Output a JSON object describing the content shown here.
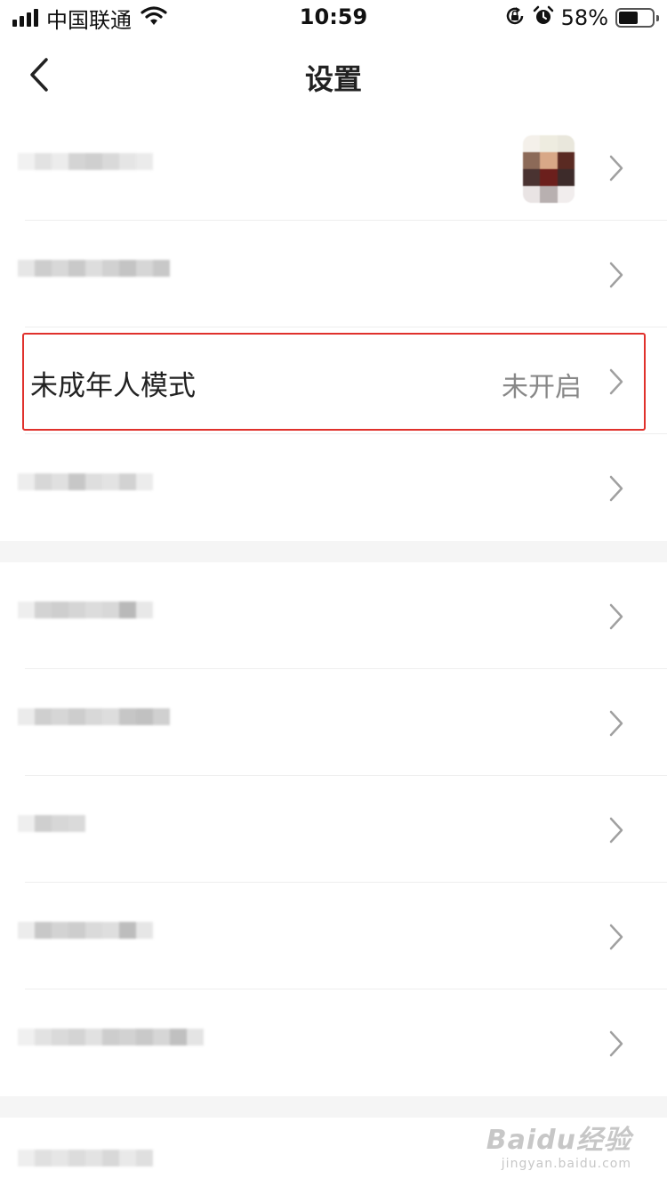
{
  "status_bar": {
    "carrier": "中国联通",
    "time": "10:59",
    "battery_percent_text": "58%",
    "battery_level": 0.58,
    "icons": [
      "signal-icon",
      "wifi-icon",
      "rotation-lock-icon",
      "alarm-icon",
      "battery-icon"
    ]
  },
  "nav": {
    "title": "设置",
    "back_icon": "chevron-left-icon"
  },
  "settings": {
    "minor_mode": {
      "label": "未成年人模式",
      "value": "未开启"
    }
  },
  "colors": {
    "highlight": "#e0312c",
    "label": "#222222",
    "value": "#888888",
    "chevron": "#a0a0a0",
    "divider": "#eeeeee",
    "section_gap": "#f5f5f5"
  },
  "watermark": {
    "main": "Baidu经验",
    "sub": "jingyan.baidu.com"
  }
}
